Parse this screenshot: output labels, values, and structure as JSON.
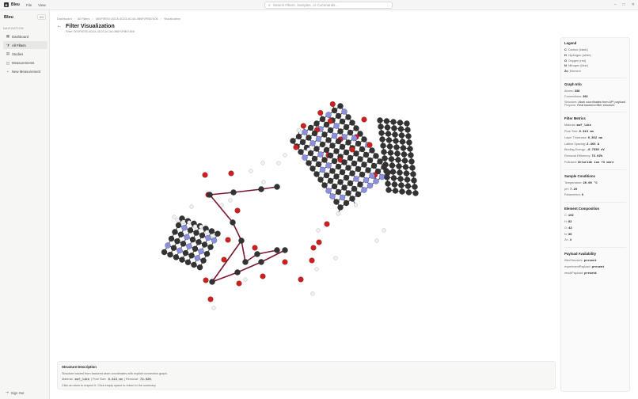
{
  "titlebar": {
    "logo_letter": "B",
    "app_name": "Bleu",
    "menu": [
      "File",
      "View"
    ],
    "search_placeholder": "Search Filters, Samples, or Commands...",
    "controls": [
      "−",
      "□",
      "✕"
    ]
  },
  "sidebar": {
    "brand": "Bleu",
    "toggle_label": "⌘B",
    "section_label": "NAVIGATION",
    "items": [
      {
        "label": "Dashboard",
        "icon": "grid-icon"
      },
      {
        "label": "All Filters",
        "icon": "filter-icon",
        "active": true
      },
      {
        "label": "Studies",
        "icon": "book-icon"
      },
      {
        "label": "Measurements",
        "icon": "chart-icon"
      },
      {
        "label": "New Measurement",
        "icon": "plus-icon"
      }
    ],
    "signout": "Sign Out"
  },
  "header": {
    "breadcrumb": [
      "Dashboard",
      "All Filters",
      "0E6F9EE0-6D2A-4D23-AC4A-0B6F0FB67A06",
      "Visualization"
    ],
    "title": "Filter Visualization",
    "subtitle": "Filter: 0E6F9EE0-6D2A-4D23-AC4A-0B6F0FB67A06"
  },
  "legend": {
    "title": "Legend",
    "items": [
      {
        "symbol": "C",
        "label": "Carbon (black)",
        "color": "#333333"
      },
      {
        "symbol": "H",
        "label": "Hydrogen (white)",
        "color": "#f0f0f0"
      },
      {
        "symbol": "O",
        "label": "Oxygen (red)",
        "color": "#cc1f1f"
      },
      {
        "symbol": "N",
        "label": "Nitrogen (blue)",
        "color": "#8a8fe0"
      },
      {
        "symbol": "Zn",
        "label": "Element",
        "color": "#8e8e8e"
      }
    ]
  },
  "graph_info": {
    "title": "Graph Info",
    "atoms_label": "Atoms:",
    "atoms": "338",
    "connections_label": "Connections:",
    "connections": "392",
    "structure_label": "Structure:",
    "structure": "Atom coordinates from API payload",
    "purpose_label": "Purpose:",
    "purpose": "Real backend filter structure"
  },
  "filter_metrics": {
    "title": "Filter Metrics",
    "rows": [
      {
        "label": "Material:",
        "value": "mof_like"
      },
      {
        "label": "Pore Size:",
        "value": "0.313 nm"
      },
      {
        "label": "Layer Thickness:",
        "value": "0.352 nm"
      },
      {
        "label": "Lattice Spacing:",
        "value": "2.466 Å"
      },
      {
        "label": "Binding Energy:",
        "value": "-0.7330 eV"
      },
      {
        "label": "Removal Efficiency:",
        "value": "73.02%"
      },
      {
        "label": "Pollutant:",
        "value": "Chloride ion +3 more"
      }
    ]
  },
  "sample_conditions": {
    "title": "Sample Conditions",
    "rows": [
      {
        "label": "Temperature:",
        "value": "20.00 °C"
      },
      {
        "label": "pH:",
        "value": "7.20"
      },
      {
        "label": "Parameters:",
        "value": "6"
      }
    ]
  },
  "element_composition": {
    "title": "Element Composition",
    "rows": [
      {
        "label": "C:",
        "value": "192"
      },
      {
        "label": "H:",
        "value": "82"
      },
      {
        "label": "O:",
        "value": "42"
      },
      {
        "label": "N:",
        "value": "30"
      },
      {
        "label": "Zn:",
        "value": "4"
      }
    ]
  },
  "payload": {
    "title": "Payload Availability",
    "rows": [
      {
        "label": "filterStructure:",
        "value": "present"
      },
      {
        "label": "experimentPayload:",
        "value": "present"
      },
      {
        "label": "resultPayload:",
        "value": "present"
      }
    ]
  },
  "description": {
    "title": "Structure Description",
    "line1": "Structure loaded from backend atom coordinates with explicit connection graph.",
    "material_label": "Material:",
    "material": "mof_like",
    "pore_label": "Pore Size:",
    "pore": "0.313 nm",
    "removal_label": "Removal:",
    "removal": "73.02%",
    "line3": "Click an atom to inspect it. Click empty space to return to the summary."
  },
  "colors": {
    "carbon": "#333333",
    "hydrogen": "#f0f0f0",
    "oxygen": "#cc1f1f",
    "nitrogen": "#8a8fe0",
    "bond": "#555555",
    "highlight_bond": "#7a1830"
  }
}
